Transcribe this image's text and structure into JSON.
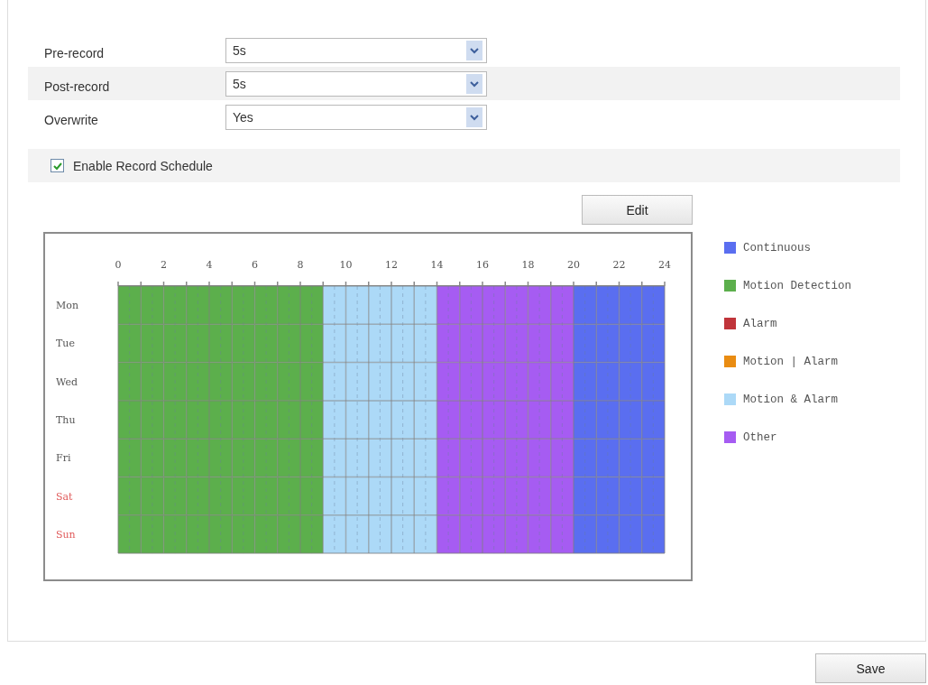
{
  "settings": [
    {
      "label": "Pre-record",
      "value": "5s",
      "shaded": false
    },
    {
      "label": "Post-record",
      "value": "5s",
      "shaded": true
    },
    {
      "label": "Overwrite",
      "value": "Yes",
      "shaded": false
    }
  ],
  "enable_schedule": {
    "label": "Enable Record Schedule",
    "checked": true
  },
  "edit_button": "Edit",
  "schedule": {
    "hours": [
      "0",
      "2",
      "4",
      "6",
      "8",
      "10",
      "12",
      "14",
      "16",
      "18",
      "20",
      "22",
      "24"
    ],
    "days": [
      {
        "name": "Mon",
        "weekend": false,
        "slots": [
          {
            "kind": "motion"
          },
          {
            "kind": "motion"
          },
          {
            "kind": "motion"
          },
          {
            "kind": "motion"
          },
          {
            "kind": "motion"
          },
          {
            "kind": "motion"
          },
          {
            "kind": "motion"
          },
          {
            "kind": "motion"
          },
          {
            "kind": "motion"
          },
          {
            "kind": "motionandalarm"
          },
          {
            "kind": "motionandalarm"
          },
          {
            "kind": "motionandalarm"
          },
          {
            "kind": "motionandalarm"
          },
          {
            "kind": "motionandalarm"
          },
          {
            "kind": "other"
          },
          {
            "kind": "other"
          },
          {
            "kind": "other"
          },
          {
            "kind": "other"
          },
          {
            "kind": "other"
          },
          {
            "kind": "other"
          },
          {
            "kind": "continuous"
          },
          {
            "kind": "continuous"
          },
          {
            "kind": "continuous"
          },
          {
            "kind": "continuous"
          }
        ]
      },
      {
        "name": "Tue",
        "weekend": false,
        "slots": [
          {
            "kind": "motion"
          },
          {
            "kind": "motion"
          },
          {
            "kind": "motion"
          },
          {
            "kind": "motion"
          },
          {
            "kind": "motion"
          },
          {
            "kind": "motion"
          },
          {
            "kind": "motion"
          },
          {
            "kind": "motion"
          },
          {
            "kind": "motion"
          },
          {
            "kind": "motionandalarm"
          },
          {
            "kind": "motionandalarm"
          },
          {
            "kind": "motionandalarm"
          },
          {
            "kind": "motionandalarm"
          },
          {
            "kind": "motionandalarm"
          },
          {
            "kind": "other"
          },
          {
            "kind": "other"
          },
          {
            "kind": "other"
          },
          {
            "kind": "other"
          },
          {
            "kind": "other"
          },
          {
            "kind": "other"
          },
          {
            "kind": "continuous"
          },
          {
            "kind": "continuous"
          },
          {
            "kind": "continuous"
          },
          {
            "kind": "continuous"
          }
        ]
      },
      {
        "name": "Wed",
        "weekend": false,
        "slots": [
          {
            "kind": "motion"
          },
          {
            "kind": "motion"
          },
          {
            "kind": "motion"
          },
          {
            "kind": "motion"
          },
          {
            "kind": "motion"
          },
          {
            "kind": "motion"
          },
          {
            "kind": "motion"
          },
          {
            "kind": "motion"
          },
          {
            "kind": "motion"
          },
          {
            "kind": "motionandalarm"
          },
          {
            "kind": "motionandalarm"
          },
          {
            "kind": "motionandalarm"
          },
          {
            "kind": "motionandalarm"
          },
          {
            "kind": "motionandalarm"
          },
          {
            "kind": "other"
          },
          {
            "kind": "other"
          },
          {
            "kind": "other"
          },
          {
            "kind": "other"
          },
          {
            "kind": "other"
          },
          {
            "kind": "other"
          },
          {
            "kind": "continuous"
          },
          {
            "kind": "continuous"
          },
          {
            "kind": "continuous"
          },
          {
            "kind": "continuous"
          }
        ]
      },
      {
        "name": "Thu",
        "weekend": false,
        "slots": [
          {
            "kind": "motion"
          },
          {
            "kind": "motion"
          },
          {
            "kind": "motion"
          },
          {
            "kind": "motion"
          },
          {
            "kind": "motion"
          },
          {
            "kind": "motion"
          },
          {
            "kind": "motion"
          },
          {
            "kind": "motion"
          },
          {
            "kind": "motion"
          },
          {
            "kind": "motionandalarm"
          },
          {
            "kind": "motionandalarm"
          },
          {
            "kind": "motionandalarm"
          },
          {
            "kind": "motionandalarm"
          },
          {
            "kind": "motionandalarm"
          },
          {
            "kind": "other"
          },
          {
            "kind": "other"
          },
          {
            "kind": "other"
          },
          {
            "kind": "other"
          },
          {
            "kind": "other"
          },
          {
            "kind": "other"
          },
          {
            "kind": "continuous"
          },
          {
            "kind": "continuous"
          },
          {
            "kind": "continuous"
          },
          {
            "kind": "continuous"
          }
        ]
      },
      {
        "name": "Fri",
        "weekend": false,
        "slots": [
          {
            "kind": "motion"
          },
          {
            "kind": "motion"
          },
          {
            "kind": "motion"
          },
          {
            "kind": "motion"
          },
          {
            "kind": "motion"
          },
          {
            "kind": "motion"
          },
          {
            "kind": "motion"
          },
          {
            "kind": "motion"
          },
          {
            "kind": "motion"
          },
          {
            "kind": "motionandalarm"
          },
          {
            "kind": "motionandalarm"
          },
          {
            "kind": "motionandalarm"
          },
          {
            "kind": "motionandalarm"
          },
          {
            "kind": "motionandalarm"
          },
          {
            "kind": "other"
          },
          {
            "kind": "other"
          },
          {
            "kind": "other"
          },
          {
            "kind": "other"
          },
          {
            "kind": "other"
          },
          {
            "kind": "other"
          },
          {
            "kind": "continuous"
          },
          {
            "kind": "continuous"
          },
          {
            "kind": "continuous"
          },
          {
            "kind": "continuous"
          }
        ]
      },
      {
        "name": "Sat",
        "weekend": true,
        "slots": [
          {
            "kind": "motion"
          },
          {
            "kind": "motion"
          },
          {
            "kind": "motion"
          },
          {
            "kind": "motion"
          },
          {
            "kind": "motion"
          },
          {
            "kind": "motion"
          },
          {
            "kind": "motion"
          },
          {
            "kind": "motion"
          },
          {
            "kind": "motion"
          },
          {
            "kind": "motionandalarm"
          },
          {
            "kind": "motionandalarm"
          },
          {
            "kind": "motionandalarm"
          },
          {
            "kind": "motionandalarm"
          },
          {
            "kind": "motionandalarm"
          },
          {
            "kind": "other"
          },
          {
            "kind": "other"
          },
          {
            "kind": "other"
          },
          {
            "kind": "other"
          },
          {
            "kind": "other"
          },
          {
            "kind": "other"
          },
          {
            "kind": "continuous"
          },
          {
            "kind": "continuous"
          },
          {
            "kind": "continuous"
          },
          {
            "kind": "continuous"
          }
        ]
      },
      {
        "name": "Sun",
        "weekend": true,
        "slots": [
          {
            "kind": "motion"
          },
          {
            "kind": "motion"
          },
          {
            "kind": "motion"
          },
          {
            "kind": "motion"
          },
          {
            "kind": "motion"
          },
          {
            "kind": "motion"
          },
          {
            "kind": "motion"
          },
          {
            "kind": "motion"
          },
          {
            "kind": "motion"
          },
          {
            "kind": "motionandalarm"
          },
          {
            "kind": "motionandalarm"
          },
          {
            "kind": "motionandalarm"
          },
          {
            "kind": "motionandalarm"
          },
          {
            "kind": "motionandalarm"
          },
          {
            "kind": "other"
          },
          {
            "kind": "other"
          },
          {
            "kind": "other"
          },
          {
            "kind": "other"
          },
          {
            "kind": "other"
          },
          {
            "kind": "other"
          },
          {
            "kind": "continuous"
          },
          {
            "kind": "continuous"
          },
          {
            "kind": "continuous"
          },
          {
            "kind": "continuous"
          }
        ]
      }
    ]
  },
  "legend": [
    {
      "kind": "continuous",
      "label": "Continuous",
      "color": "#5a6ef0"
    },
    {
      "kind": "motion",
      "label": "Motion Detection",
      "color": "#5caf4c"
    },
    {
      "kind": "alarm",
      "label": "Alarm",
      "color": "#c0343a"
    },
    {
      "kind": "motionoralarm",
      "label": "Motion | Alarm",
      "color": "#e98c12"
    },
    {
      "kind": "motionandalarm",
      "label": "Motion & Alarm",
      "color": "#acd9f7"
    },
    {
      "kind": "other",
      "label": "Other",
      "color": "#a65cf2"
    }
  ],
  "save_button": "Save"
}
